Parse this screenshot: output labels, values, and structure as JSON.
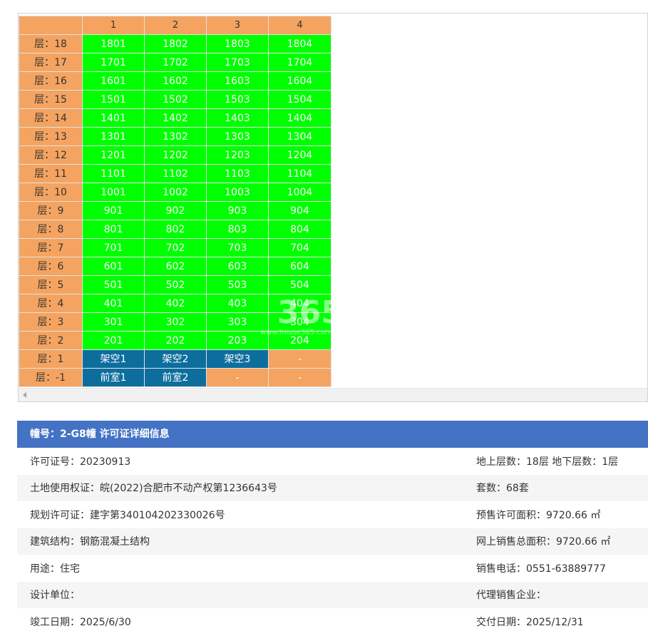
{
  "unit_table": {
    "columns": [
      "",
      "1",
      "2",
      "3",
      "4"
    ],
    "rows": [
      {
        "floor": "层：18",
        "cells": [
          {
            "text": "1801",
            "kind": "green"
          },
          {
            "text": "1802",
            "kind": "green"
          },
          {
            "text": "1803",
            "kind": "green"
          },
          {
            "text": "1804",
            "kind": "green"
          }
        ]
      },
      {
        "floor": "层：17",
        "cells": [
          {
            "text": "1701",
            "kind": "green"
          },
          {
            "text": "1702",
            "kind": "green"
          },
          {
            "text": "1703",
            "kind": "green"
          },
          {
            "text": "1704",
            "kind": "green"
          }
        ]
      },
      {
        "floor": "层：16",
        "cells": [
          {
            "text": "1601",
            "kind": "green"
          },
          {
            "text": "1602",
            "kind": "green"
          },
          {
            "text": "1603",
            "kind": "green"
          },
          {
            "text": "1604",
            "kind": "green"
          }
        ]
      },
      {
        "floor": "层：15",
        "cells": [
          {
            "text": "1501",
            "kind": "green"
          },
          {
            "text": "1502",
            "kind": "green"
          },
          {
            "text": "1503",
            "kind": "green"
          },
          {
            "text": "1504",
            "kind": "green"
          }
        ]
      },
      {
        "floor": "层：14",
        "cells": [
          {
            "text": "1401",
            "kind": "green"
          },
          {
            "text": "1402",
            "kind": "green"
          },
          {
            "text": "1403",
            "kind": "green"
          },
          {
            "text": "1404",
            "kind": "green"
          }
        ]
      },
      {
        "floor": "层：13",
        "cells": [
          {
            "text": "1301",
            "kind": "green"
          },
          {
            "text": "1302",
            "kind": "green"
          },
          {
            "text": "1303",
            "kind": "green"
          },
          {
            "text": "1304",
            "kind": "green"
          }
        ]
      },
      {
        "floor": "层：12",
        "cells": [
          {
            "text": "1201",
            "kind": "green"
          },
          {
            "text": "1202",
            "kind": "green"
          },
          {
            "text": "1203",
            "kind": "green"
          },
          {
            "text": "1204",
            "kind": "green"
          }
        ]
      },
      {
        "floor": "层：11",
        "cells": [
          {
            "text": "1101",
            "kind": "green"
          },
          {
            "text": "1102",
            "kind": "green"
          },
          {
            "text": "1103",
            "kind": "green"
          },
          {
            "text": "1104",
            "kind": "green"
          }
        ]
      },
      {
        "floor": "层：10",
        "cells": [
          {
            "text": "1001",
            "kind": "green"
          },
          {
            "text": "1002",
            "kind": "green"
          },
          {
            "text": "1003",
            "kind": "green"
          },
          {
            "text": "1004",
            "kind": "green"
          }
        ]
      },
      {
        "floor": "层：9",
        "cells": [
          {
            "text": "901",
            "kind": "green"
          },
          {
            "text": "902",
            "kind": "green"
          },
          {
            "text": "903",
            "kind": "green"
          },
          {
            "text": "904",
            "kind": "green"
          }
        ]
      },
      {
        "floor": "层：8",
        "cells": [
          {
            "text": "801",
            "kind": "green"
          },
          {
            "text": "802",
            "kind": "green"
          },
          {
            "text": "803",
            "kind": "green"
          },
          {
            "text": "804",
            "kind": "green"
          }
        ]
      },
      {
        "floor": "层：7",
        "cells": [
          {
            "text": "701",
            "kind": "green"
          },
          {
            "text": "702",
            "kind": "green"
          },
          {
            "text": "703",
            "kind": "green"
          },
          {
            "text": "704",
            "kind": "green"
          }
        ]
      },
      {
        "floor": "层：6",
        "cells": [
          {
            "text": "601",
            "kind": "green"
          },
          {
            "text": "602",
            "kind": "green"
          },
          {
            "text": "603",
            "kind": "green"
          },
          {
            "text": "604",
            "kind": "green"
          }
        ]
      },
      {
        "floor": "层：5",
        "cells": [
          {
            "text": "501",
            "kind": "green"
          },
          {
            "text": "502",
            "kind": "green"
          },
          {
            "text": "503",
            "kind": "green"
          },
          {
            "text": "504",
            "kind": "green"
          }
        ]
      },
      {
        "floor": "层：4",
        "cells": [
          {
            "text": "401",
            "kind": "green"
          },
          {
            "text": "402",
            "kind": "green"
          },
          {
            "text": "403",
            "kind": "green"
          },
          {
            "text": "404",
            "kind": "green"
          }
        ]
      },
      {
        "floor": "层：3",
        "cells": [
          {
            "text": "301",
            "kind": "green"
          },
          {
            "text": "302",
            "kind": "green"
          },
          {
            "text": "303",
            "kind": "green"
          },
          {
            "text": "304",
            "kind": "green"
          }
        ]
      },
      {
        "floor": "层：2",
        "cells": [
          {
            "text": "201",
            "kind": "green"
          },
          {
            "text": "202",
            "kind": "green"
          },
          {
            "text": "203",
            "kind": "green"
          },
          {
            "text": "204",
            "kind": "green"
          }
        ]
      },
      {
        "floor": "层：1",
        "cells": [
          {
            "text": "架空1",
            "kind": "blue"
          },
          {
            "text": "架空2",
            "kind": "blue"
          },
          {
            "text": "架空3",
            "kind": "blue"
          },
          {
            "text": "-",
            "kind": "empty"
          }
        ]
      },
      {
        "floor": "层：-1",
        "cells": [
          {
            "text": "前室1",
            "kind": "blue"
          },
          {
            "text": "前室2",
            "kind": "blue"
          },
          {
            "text": "-",
            "kind": "empty"
          },
          {
            "text": "-",
            "kind": "empty"
          }
        ]
      }
    ]
  },
  "watermark": {
    "big": "365",
    "small": "www.house365.com"
  },
  "colors": {
    "header_orange": "#f4a460",
    "available_green": "#00ff00",
    "special_blue": "#0d6e9e",
    "info_header_blue": "#4472c4"
  },
  "info": {
    "title": "幢号：2-G8幢 许可证详细信息",
    "rows": [
      {
        "left": "许可证号：20230913",
        "right": "地上层数：18层  地下层数：1层"
      },
      {
        "left": "土地使用权证：皖(2022)合肥市不动产权第1236643号",
        "right": "套数：68套"
      },
      {
        "left": "规划许可证：建字第340104202330026号",
        "right": "预售许可面积：9720.66 ㎡"
      },
      {
        "left": "建筑结构：钢筋混凝土结构",
        "right": "网上销售总面积：9720.66 ㎡"
      },
      {
        "left": "用途：住宅",
        "right": "销售电话：0551-63889777"
      },
      {
        "left": "设计单位：",
        "right": "代理销售企业："
      },
      {
        "left": "竣工日期：2025/6/30",
        "right": "交付日期：2025/12/31"
      }
    ]
  }
}
